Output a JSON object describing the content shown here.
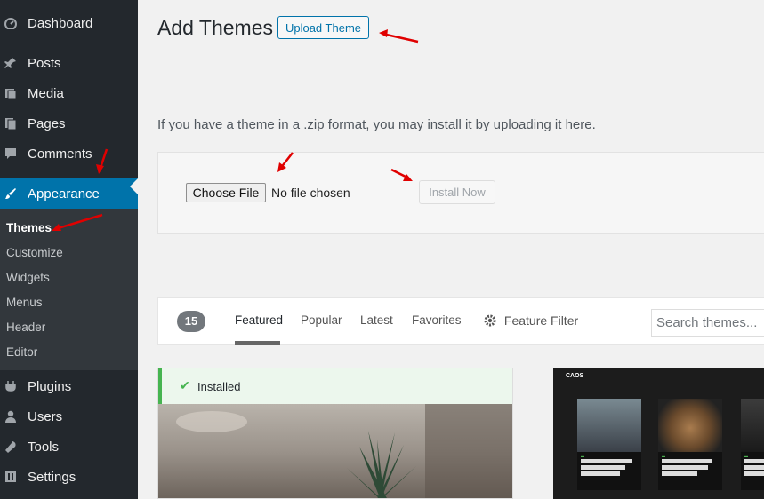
{
  "sidebar": {
    "items": [
      {
        "label": "Dashboard",
        "icon": "dashboard-icon"
      },
      {
        "label": "Posts",
        "icon": "pin-icon"
      },
      {
        "label": "Media",
        "icon": "media-icon"
      },
      {
        "label": "Pages",
        "icon": "pages-icon"
      },
      {
        "label": "Comments",
        "icon": "comment-icon"
      },
      {
        "label": "Appearance",
        "icon": "brush-icon"
      },
      {
        "label": "Plugins",
        "icon": "plugin-icon"
      },
      {
        "label": "Users",
        "icon": "user-icon"
      },
      {
        "label": "Tools",
        "icon": "wrench-icon"
      },
      {
        "label": "Settings",
        "icon": "settings-icon"
      }
    ],
    "submenu": [
      "Themes",
      "Customize",
      "Widgets",
      "Menus",
      "Header",
      "Editor"
    ]
  },
  "header": {
    "title": "Add Themes",
    "upload_button": "Upload Theme"
  },
  "upload": {
    "help_text": "If you have a theme in a .zip format, you may install it by uploading it here.",
    "choose_button": "Choose File",
    "no_file": "No file chosen",
    "install_button": "Install Now"
  },
  "filter": {
    "count": "15",
    "tabs": [
      "Featured",
      "Popular",
      "Latest",
      "Favorites"
    ],
    "feature_filter": "Feature Filter",
    "search_placeholder": "Search themes..."
  },
  "themes": {
    "installed_label": "Installed",
    "preview_logo": "CAOS"
  },
  "colors": {
    "sidebar": "#23282d",
    "accent": "#0073aa",
    "installed": "#46b450",
    "annotation": "#e00000"
  }
}
